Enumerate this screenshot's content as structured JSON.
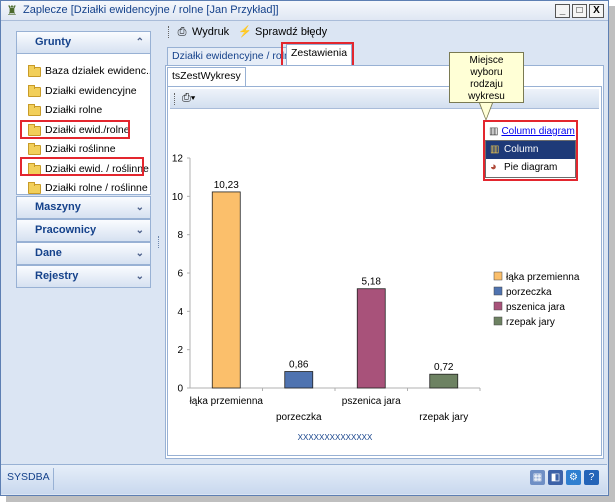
{
  "window": {
    "title": "Zaplecze [Działki ewidencyjne / rolne [Jan Przykład]]",
    "controls": [
      "_",
      "□",
      "X"
    ]
  },
  "nav": {
    "groups": [
      {
        "label": "Grunty",
        "expanded": true
      },
      {
        "label": "Maszyny",
        "expanded": false
      },
      {
        "label": "Pracownicy",
        "expanded": false
      },
      {
        "label": "Dane",
        "expanded": false
      },
      {
        "label": "Rejestry",
        "expanded": false
      }
    ],
    "items": [
      "Baza działek ewidenc...",
      "Działki ewidencyjne",
      "Działki rolne",
      "Działki ewid./rolne",
      "Działki roślinne",
      "Działki ewid. / roślinne",
      "Działki rolne / roślinne"
    ]
  },
  "toolbar": {
    "print_label": "Wydruk",
    "check_label": "Sprawdź błędy"
  },
  "tabs": {
    "items": [
      "Działki ewidencyjne / rolne",
      "Zestawienia"
    ],
    "active": "Zestawienia",
    "subtab": "tsZestWykresy"
  },
  "callout": {
    "text": [
      "Miejsce",
      "wyboru",
      "rodzaju",
      "wykresu"
    ]
  },
  "chart_selector": {
    "current": "Column diagram",
    "options": [
      "Column diagram",
      "Pie diagram"
    ],
    "selected": "Column diagram"
  },
  "chart_data": {
    "type": "bar",
    "categories": [
      "łąka przemienna",
      "porzeczka",
      "pszenica jara",
      "rzepak jary"
    ],
    "values": [
      10.23,
      0.86,
      5.18,
      0.72
    ],
    "value_labels": [
      "10,23",
      "0,86",
      "5,18",
      "0,72"
    ],
    "colors": [
      "#fbbf6b",
      "#4f73b0",
      "#a8527a",
      "#6d8262"
    ],
    "xlabel": "XXXXXXXXXXXXXX",
    "ylim": [
      0,
      12
    ],
    "yticks": [
      0,
      2,
      4,
      6,
      8,
      10,
      12
    ],
    "legend": {
      "placement": "right",
      "entries": [
        "łąka przemienna",
        "porzeczka",
        "pszenica jara",
        "rzepak jary"
      ]
    },
    "grid": false
  },
  "status": {
    "db": "SYSDBA"
  }
}
